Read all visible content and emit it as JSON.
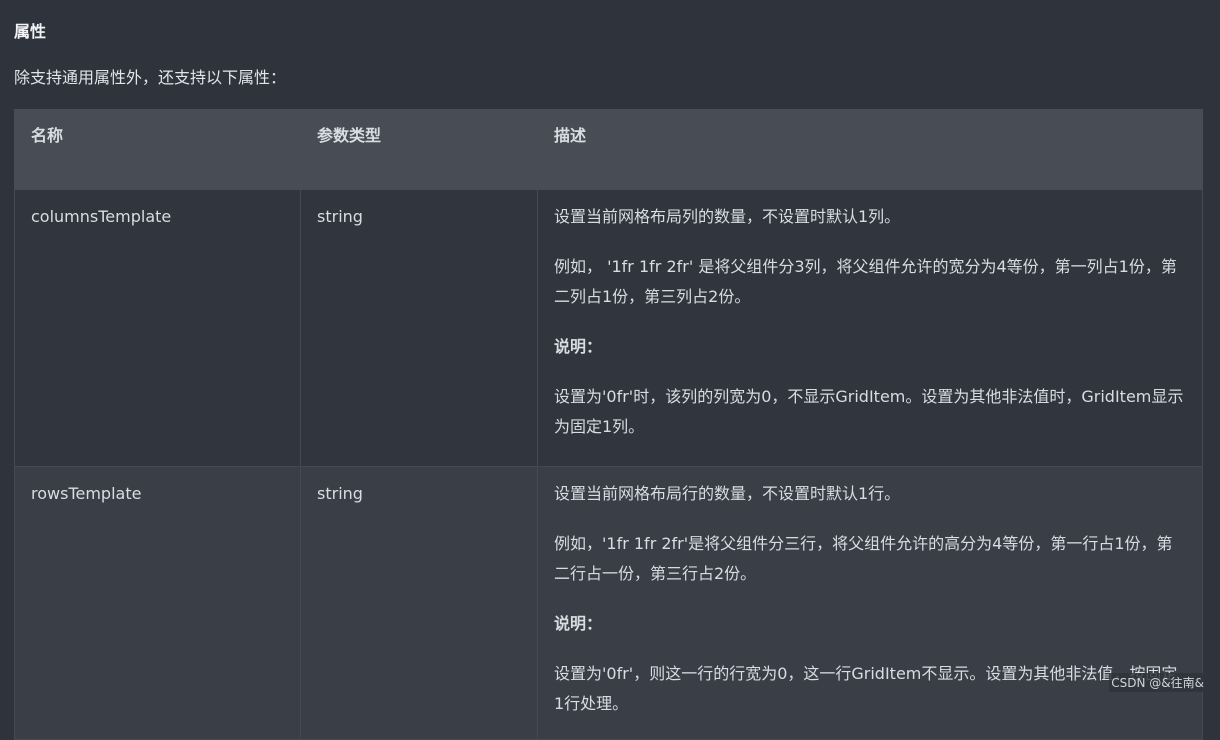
{
  "section": {
    "title": "属性",
    "intro": "除支持通用属性外，还支持以下属性："
  },
  "table": {
    "headers": [
      "名称",
      "参数类型",
      "描述"
    ],
    "rows": [
      {
        "name": "columnsTemplate",
        "type": "string",
        "desc_1": "设置当前网格布局列的数量，不设置时默认1列。",
        "desc_2": "例如，  '1fr 1fr 2fr' 是将父组件分3列，将父组件允许的宽分为4等份，第一列占1份，第二列占1份，第三列占2份。",
        "note_label": "说明：",
        "note_text": "设置为'0fr'时，该列的列宽为0，不显示GridItem。设置为其他非法值时，GridItem显示为固定1列。"
      },
      {
        "name": "rowsTemplate",
        "type": "string",
        "desc_1": "设置当前网格布局行的数量，不设置时默认1行。",
        "desc_2": "例如，'1fr 1fr 2fr'是将父组件分三行，将父组件允许的高分为4等份，第一行占1份，第二行占一份，第三行占2份。",
        "note_label": "说明：",
        "note_text": "设置为'0fr'，则这一行的行宽为0，这一行GridItem不显示。设置为其他非法值，按固定1行处理。"
      }
    ]
  },
  "watermark": "CSDN @&往南&"
}
